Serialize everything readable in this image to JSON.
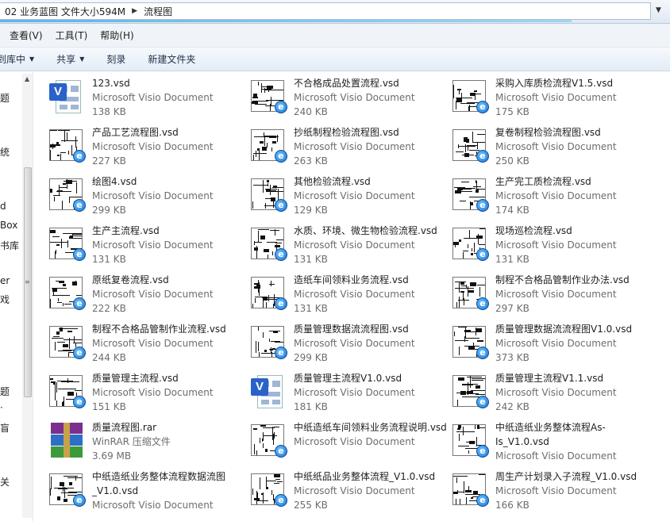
{
  "address": {
    "crumbs": [
      "02 业务蓝图 文件大小594M",
      "流程图"
    ]
  },
  "menu": [
    "查看(V)",
    "工具(T)",
    "帮助(H)"
  ],
  "toolbar": {
    "include_library": "到库中",
    "share": "共享",
    "burn": "刻录",
    "new_folder": "新建文件夹"
  },
  "nav_fragments": [
    "题",
    "统",
    "d",
    "Box",
    "书库",
    "er",
    "戏",
    "题",
    "·",
    "盲",
    "关"
  ],
  "files": [
    {
      "name": "123.vsd",
      "type": "Microsoft Visio Document",
      "size": "138 KB",
      "icon": "visio-icon"
    },
    {
      "name": "不合格成品处置流程.vsd",
      "type": "Microsoft Visio Document",
      "size": "240 KB",
      "icon": "diagram-ie-icon"
    },
    {
      "name": "采购入库质检流程V1.5.vsd",
      "type": "Microsoft Visio Document",
      "size": "175 KB",
      "icon": "diagram-ie-icon"
    },
    {
      "name": "产品工艺流程图.vsd",
      "type": "Microsoft Visio Document",
      "size": "227 KB",
      "icon": "diagram-ie-icon"
    },
    {
      "name": "抄纸制程检验流程图.vsd",
      "type": "Microsoft Visio Document",
      "size": "263 KB",
      "icon": "diagram-ie-icon"
    },
    {
      "name": "复卷制程检验流程图.vsd",
      "type": "Microsoft Visio Document",
      "size": "250 KB",
      "icon": "diagram-ie-icon"
    },
    {
      "name": "绘图4.vsd",
      "type": "Microsoft Visio Document",
      "size": "299 KB",
      "icon": "diagram-ie-icon"
    },
    {
      "name": "其他检验流程.vsd",
      "type": "Microsoft Visio Document",
      "size": "129 KB",
      "icon": "diagram-ie-icon"
    },
    {
      "name": "生产完工质检流程.vsd",
      "type": "Microsoft Visio Document",
      "size": "174 KB",
      "icon": "diagram-ie-icon"
    },
    {
      "name": "生产主流程.vsd",
      "type": "Microsoft Visio Document",
      "size": "131 KB",
      "icon": "diagram-ie-icon"
    },
    {
      "name": "水质、环境、微生物检验流程.vsd",
      "type": "Microsoft Visio Document",
      "size": "131 KB",
      "icon": "diagram-ie-icon"
    },
    {
      "name": "现场巡检流程.vsd",
      "type": "Microsoft Visio Document",
      "size": "131 KB",
      "icon": "diagram-ie-icon"
    },
    {
      "name": "原纸复卷流程.vsd",
      "type": "Microsoft Visio Document",
      "size": "222 KB",
      "icon": "diagram-ie-icon"
    },
    {
      "name": "造纸车间领料业务流程.vsd",
      "type": "Microsoft Visio Document",
      "size": "131 KB",
      "icon": "diagram-ie-icon"
    },
    {
      "name": "制程不合格品管制作业办法.vsd",
      "type": "Microsoft Visio Document",
      "size": "297 KB",
      "icon": "diagram-ie-icon"
    },
    {
      "name": "制程不合格品管制作业流程.vsd",
      "type": "Microsoft Visio Document",
      "size": "244 KB",
      "icon": "diagram-ie-icon"
    },
    {
      "name": "质量管理数据流流程图.vsd",
      "type": "Microsoft Visio Document",
      "size": "299 KB",
      "icon": "diagram-ie-icon"
    },
    {
      "name": "质量管理数据流流程图V1.0.vsd",
      "type": "Microsoft Visio Document",
      "size": "373 KB",
      "icon": "diagram-ie-icon"
    },
    {
      "name": "质量管理主流程.vsd",
      "type": "Microsoft Visio Document",
      "size": "151 KB",
      "icon": "diagram-ie-icon"
    },
    {
      "name": "质量管理主流程V1.0.vsd",
      "type": "Microsoft Visio Document",
      "size": "181 KB",
      "icon": "visio-icon"
    },
    {
      "name": "质量管理主流程V1.1.vsd",
      "type": "Microsoft Visio Document",
      "size": "242 KB",
      "icon": "diagram-ie-icon"
    },
    {
      "name": "质量流程图.rar",
      "type": "WinRAR 压缩文件",
      "size": "3.69 MB",
      "icon": "winrar-icon"
    },
    {
      "name": "中纸造纸车间领料业务流程说明.vsd",
      "type": "Microsoft Visio Document",
      "size": "",
      "icon": "diagram-ie-icon"
    },
    {
      "name": "中纸造纸业务整体流程As-Is_V1.0.vsd",
      "type": "Microsoft Visio Document",
      "size": "",
      "icon": "diagram-ie-icon"
    },
    {
      "name": "中纸造纸业务整体流程数据流图_V1.0.vsd",
      "type": "Microsoft Visio Document",
      "size": "",
      "icon": "diagram-ie-icon"
    },
    {
      "name": "中纸纸品业务整体流程_V1.0.vsd",
      "type": "Microsoft Visio Document",
      "size": "255 KB",
      "icon": "diagram-ie-icon"
    },
    {
      "name": "周生产计划录入子流程_V1.0.vsd",
      "type": "Microsoft Visio Document",
      "size": "166 KB",
      "icon": "diagram-ie-icon"
    }
  ]
}
